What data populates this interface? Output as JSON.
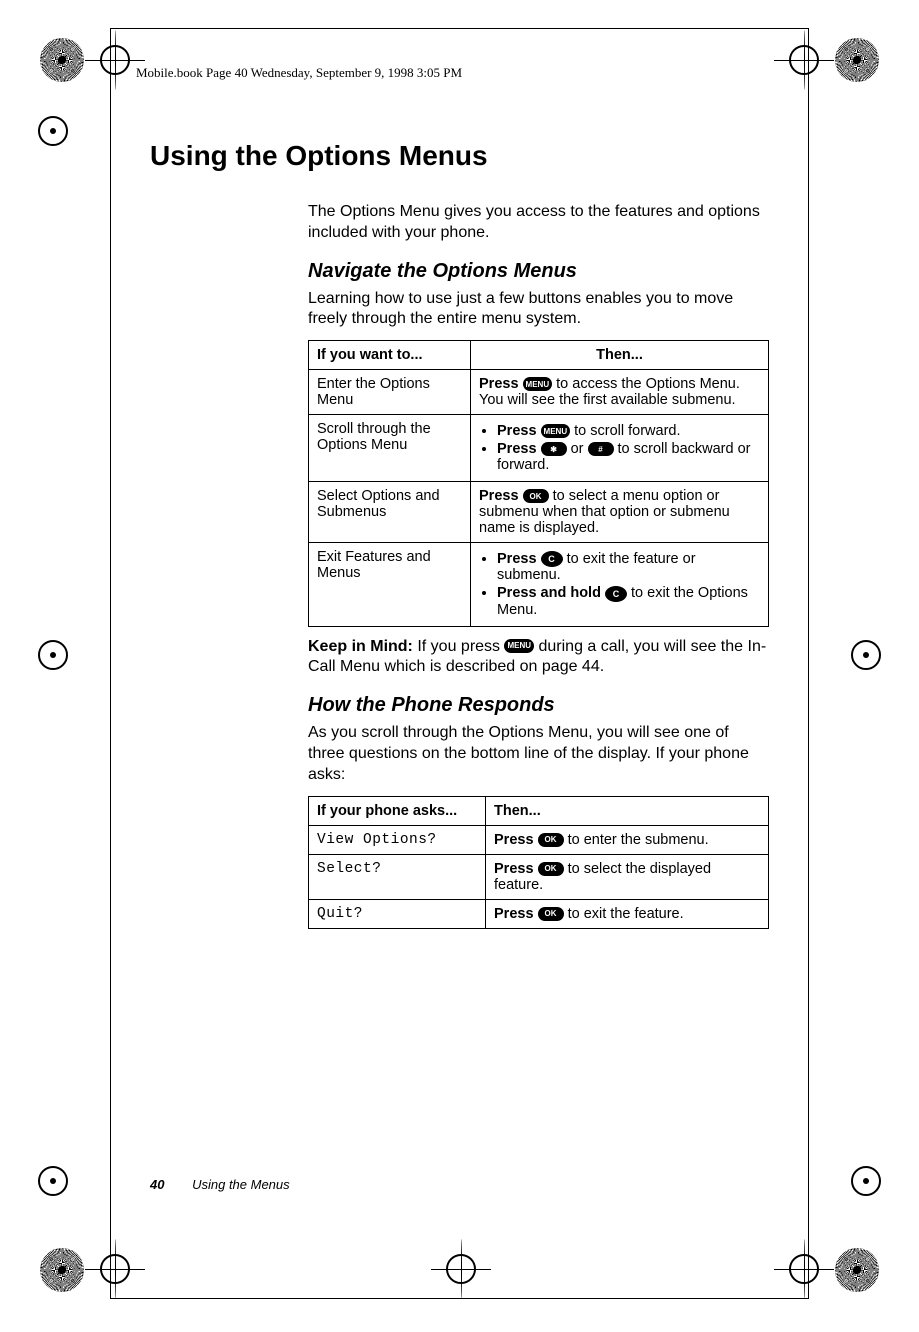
{
  "header": "Mobile.book  Page 40  Wednesday, September 9, 1998  3:05 PM",
  "chapter_title": "Using the Options Menus",
  "intro": "The Options Menu gives you access to the features and options included with your phone.",
  "section1": {
    "title": "Navigate the Options Menus",
    "intro": "Learning how to use just a few buttons enables you to move freely through the entire menu system."
  },
  "table1": {
    "head": {
      "c1": "If you want to...",
      "c2": "Then..."
    },
    "rows": [
      {
        "c1": "Enter the Options Menu",
        "press": "Press ",
        "key": "MENU",
        "after": " to access the Options Menu. You will see the first available submenu."
      },
      {
        "c1": "Scroll through the Options Menu",
        "li1_press": "Press ",
        "li1_key": "MENU",
        "li1_after": " to scroll forward.",
        "li2_press": "Press ",
        "li2_key1": "✱",
        "li2_or": " or ",
        "li2_key2": "#",
        "li2_after": " to scroll backward or forward."
      },
      {
        "c1": "Select Options and Submenus",
        "press": "Press ",
        "key": "OK",
        "after": " to select a menu option or submenu when that option or submenu name is displayed."
      },
      {
        "c1": "Exit Features and Menus",
        "li1_press": "Press ",
        "li1_key": "C",
        "li1_after": " to exit the feature or submenu.",
        "li2_press": "Press and hold ",
        "li2_key": "C",
        "li2_after": " to exit the Options Menu."
      }
    ]
  },
  "keep_label": "Keep in Mind:",
  "keep_before": " If you press ",
  "keep_key": "MENU",
  "keep_after": " during a call, you will see the In-Call Menu which is described on page 44.",
  "section2": {
    "title": "How the Phone Responds",
    "intro": "As you scroll through the Options Menu, you will see one of three questions on the bottom line of the display. If your phone asks:"
  },
  "table2": {
    "head": {
      "c1": "If your phone asks...",
      "c2": "Then..."
    },
    "rows": [
      {
        "c1": "View Options?",
        "press": "Press ",
        "key": "OK",
        "after": " to enter the submenu."
      },
      {
        "c1": "Select?",
        "press": "Press ",
        "key": "OK",
        "after": " to select the displayed feature."
      },
      {
        "c1": "Quit?",
        "press": "Press ",
        "key": "OK",
        "after": " to exit the feature."
      }
    ]
  },
  "footer": {
    "page": "40",
    "label": "Using the Menus"
  }
}
